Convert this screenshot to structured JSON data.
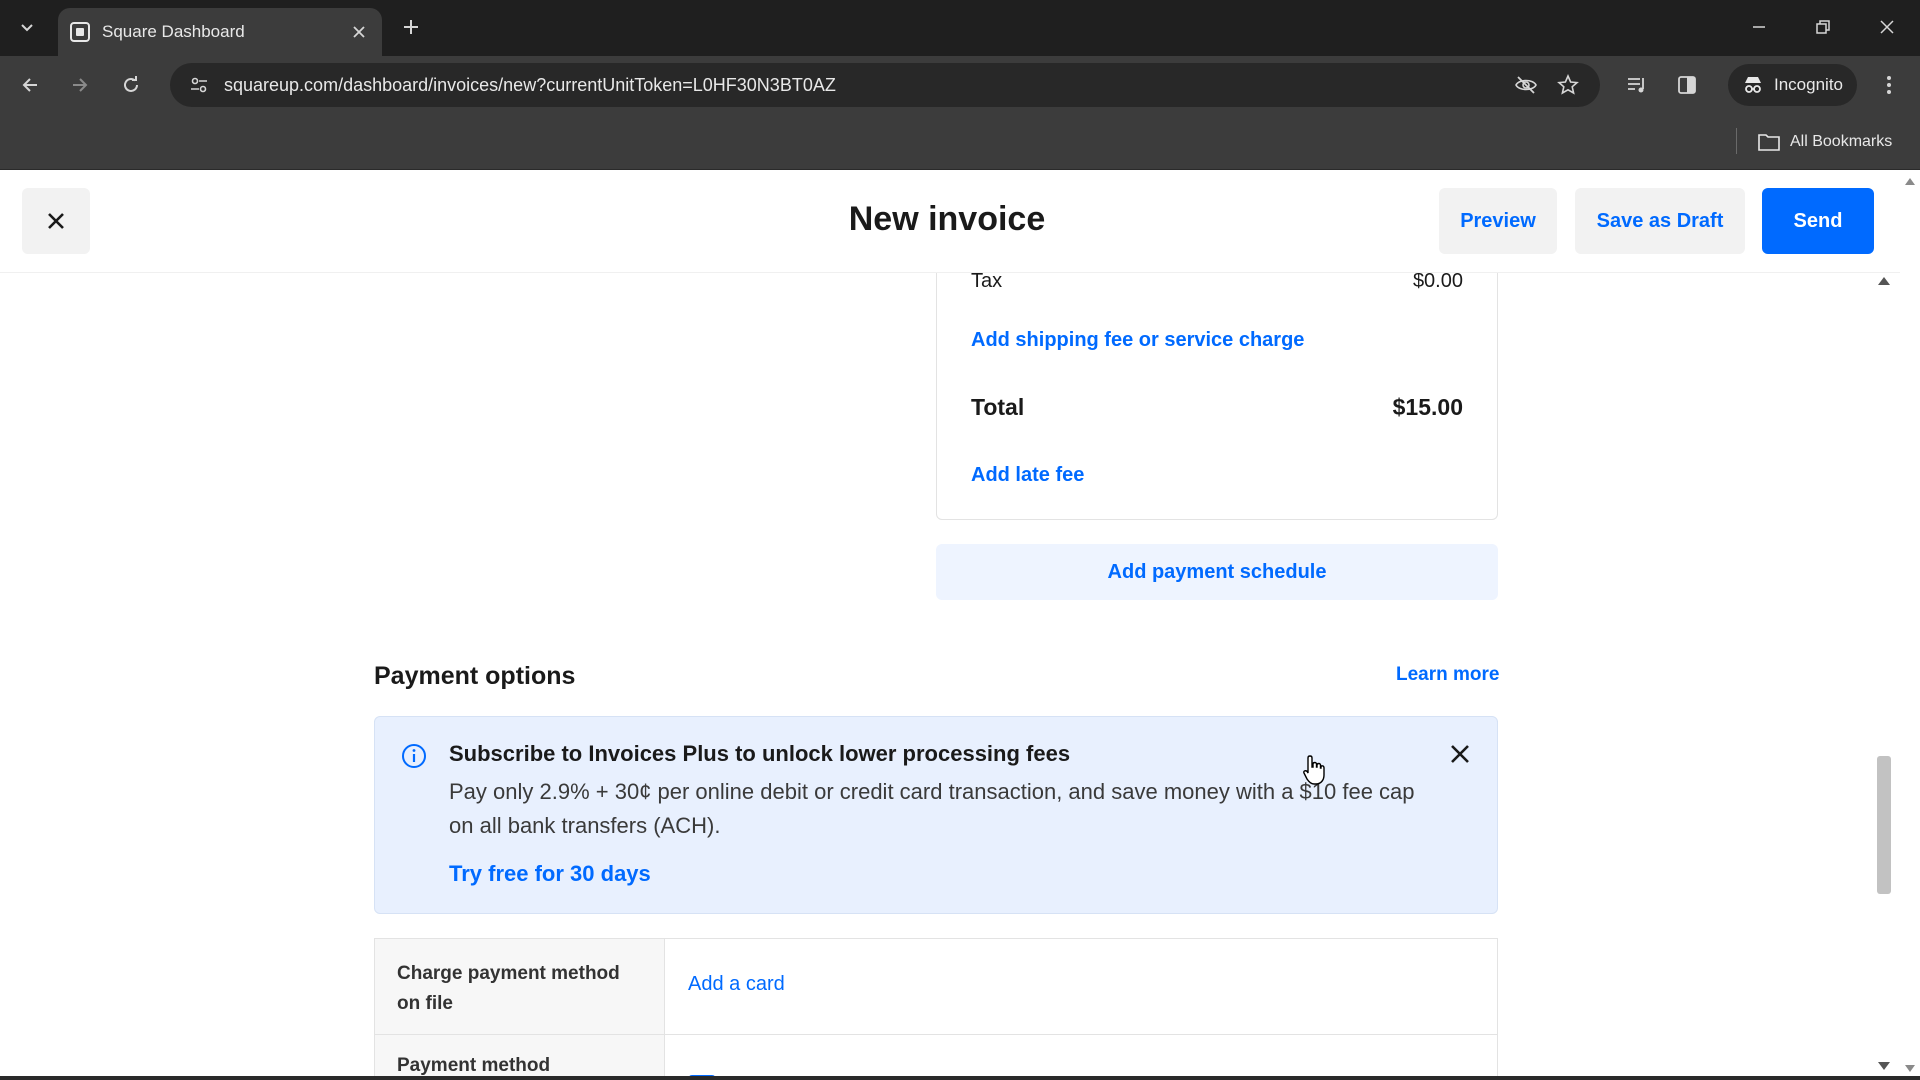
{
  "browser": {
    "tab_title": "Square Dashboard",
    "url": "squareup.com/dashboard/invoices/new?currentUnitToken=L0HF30N3BT0AZ",
    "incognito_label": "Incognito",
    "all_bookmarks_label": "All Bookmarks"
  },
  "header": {
    "title": "New invoice",
    "preview_label": "Preview",
    "save_draft_label": "Save as Draft",
    "send_label": "Send"
  },
  "summary": {
    "tax_label": "Tax",
    "tax_value": "$0.00",
    "shipping_link": "Add shipping fee or service charge",
    "total_label": "Total",
    "total_value": "$15.00",
    "late_fee_link": "Add late fee",
    "payment_schedule_label": "Add payment schedule"
  },
  "payment_options": {
    "title": "Payment options",
    "learn_more": "Learn more",
    "promo": {
      "title": "Subscribe to Invoices Plus to unlock lower processing fees",
      "body": "Pay only 2.9% + 30¢ per online debit or credit card transaction, and save money with a $10 fee cap on all bank transfers (ACH).",
      "cta": "Try free for 30 days"
    },
    "rows": [
      {
        "label": "Charge payment method on file",
        "action": "Add a card"
      },
      {
        "label": "Payment method"
      }
    ]
  },
  "colors": {
    "accent": "#006aff",
    "promo_bg": "#e8f0fe",
    "chrome_dark": "#1f1f1f",
    "chrome_toolbar": "#3c3c3c"
  },
  "icons": {
    "tab_list": "chevron-down-icon",
    "favicon": "square-logo-icon",
    "close_tab": "close-icon",
    "new_tab": "plus-icon",
    "back": "arrow-left-icon",
    "forward": "arrow-right-icon",
    "reload": "reload-icon",
    "site_settings": "tune-icon",
    "eye_off": "eye-off-icon",
    "bookmark_star": "star-icon",
    "media": "media-control-icon",
    "side_panel": "side-panel-icon",
    "incognito": "incognito-icon",
    "menu": "kebab-menu-icon",
    "folder": "folder-icon",
    "info": "info-icon"
  }
}
